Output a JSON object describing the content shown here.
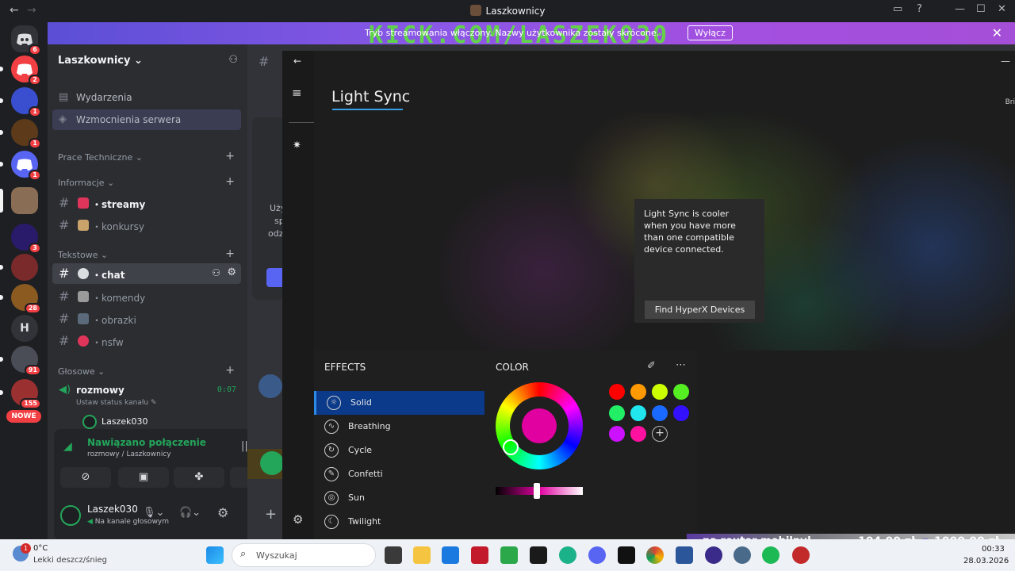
{
  "window": {
    "title": "Laszkownicy",
    "back": "←",
    "forward": "→"
  },
  "banner": {
    "overlay": "KICK.COM/LASZEK030",
    "message": "Tryb streamowania włączony. Nazwy użytkownika zostały skrócone.",
    "button": "Wyłącz"
  },
  "rail": {
    "badges": [
      "6",
      "2",
      "1",
      "1",
      "1",
      "3",
      "28",
      "91",
      "155"
    ],
    "letter_server": "H",
    "new_badge": "NOWE"
  },
  "sidebar": {
    "server_name": "Laszkownicy",
    "events": "Wydarzenia",
    "boosts": "Wzmocnienia serwera",
    "categories": {
      "prace": "Prace Techniczne",
      "informacje": "Informacje",
      "tekstowe": "Tekstowe",
      "glosowe": "Głosowe"
    },
    "channels": {
      "streamy": "・streamy",
      "konkursy": "・konkursy",
      "chat": "・chat",
      "komendy": "・komendy",
      "obrazki": "・obrazki",
      "nsfw": "・nsfw"
    },
    "voice": {
      "channel": "rozmowy",
      "time": "0:07",
      "status": "Ustaw status kanału",
      "member": "Laszek030"
    }
  },
  "voice_panel": {
    "status": "Nawiązano połączenie",
    "location": "rozmowy / Laszkownicy"
  },
  "user": {
    "name": "Laszek030",
    "status": "Na kanale głosowym"
  },
  "background_text": [
    "Użyj",
    "spe",
    "odzn"
  ],
  "lightsync": {
    "title": "Light Sync",
    "right_cut": "Bri",
    "tooltip": "Light Sync is cooler when you have more than one compatible device connected.",
    "find_button": "Find HyperX Devices",
    "effects_header": "EFFECTS",
    "color_header": "COLOR",
    "effects": [
      "Solid",
      "Breathing",
      "Cycle",
      "Confetti",
      "Sun",
      "Twilight"
    ],
    "selected_effect": "Solid",
    "current_color": "#e100a0",
    "swatches": [
      "#ff0000",
      "#ff9900",
      "#ccff00",
      "#55ee22",
      "#22ee66",
      "#22e6ee",
      "#1a6aff",
      "#3311ff",
      "#cc11ff",
      "#ff11a0"
    ],
    "more": "⋯"
  },
  "taskbar": {
    "weather_temp": "0°C",
    "weather_desc": "Lekki deszcz/śnieg",
    "weather_badge": "1",
    "search_placeholder": "Wyszukaj",
    "clock": "00:33",
    "date": "28.03.2026",
    "promo_left": "na router mobilny!",
    "promo_price1": "104,00 zł",
    "promo_sep": "z",
    "promo_price2": "1000,00 zł"
  }
}
